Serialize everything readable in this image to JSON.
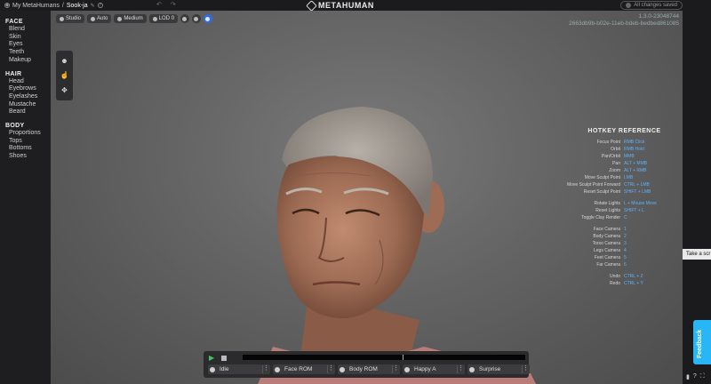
{
  "breadcrumb": {
    "parent": "My MetaHumans",
    "separator": "/",
    "current": "Sook-ja"
  },
  "app": {
    "title": "METAHUMAN"
  },
  "status": {
    "saved": "All changes saved"
  },
  "version": {
    "line1": "1.3.0-23048744",
    "line2": "2663db9b-b02e-11eb-bdeb-bedbed861085"
  },
  "toolbar": {
    "studio": "Studio",
    "auto": "Auto",
    "medium": "Medium",
    "lod": "LOD 0"
  },
  "sidebar": {
    "sections": [
      {
        "title": "FACE",
        "items": [
          "Blend",
          "Skin",
          "Eyes",
          "Teeth",
          "Makeup"
        ]
      },
      {
        "title": "HAIR",
        "items": [
          "Head",
          "Eyebrows",
          "Eyelashes",
          "Mustache",
          "Beard"
        ]
      },
      {
        "title": "BODY",
        "items": [
          "Proportions",
          "Tops",
          "Bottoms",
          "Shoes"
        ]
      }
    ]
  },
  "hotkeys": {
    "title": "HOTKEY REFERENCE",
    "groups": [
      [
        {
          "a": "Focus Point",
          "k": "RMB Click"
        },
        {
          "a": "Orbit",
          "k": "RMB Hold"
        },
        {
          "a": "Pan/Orbit",
          "k": "MMB"
        },
        {
          "a": "Pan",
          "k": "ALT + MMB"
        },
        {
          "a": "Zoom",
          "k": "ALT + RMB"
        },
        {
          "a": "Move Sculpt Point",
          "k": "LMB"
        },
        {
          "a": "Move Sculpt Point Forward",
          "k": "CTRL + LMB"
        },
        {
          "a": "Reset Sculpt Point",
          "k": "SHIFT + LMB"
        }
      ],
      [
        {
          "a": "Rotate Lights",
          "k": "L + Mouse Move"
        },
        {
          "a": "Reset Lights",
          "k": "SHIFT + L"
        },
        {
          "a": "Toggle Clay Render",
          "k": "C"
        }
      ],
      [
        {
          "a": "Face Camera",
          "k": "1"
        },
        {
          "a": "Body Camera",
          "k": "2"
        },
        {
          "a": "Torso Camera",
          "k": "3"
        },
        {
          "a": "Legs Camera",
          "k": "4"
        },
        {
          "a": "Feet Camera",
          "k": "5"
        },
        {
          "a": "Far Camera",
          "k": "6"
        }
      ],
      [
        {
          "a": "Undo",
          "k": "CTRL + Z"
        },
        {
          "a": "Redo",
          "k": "CTRL + Y"
        }
      ]
    ]
  },
  "animations": [
    "Idle",
    "Face ROM",
    "Body ROM",
    "Happy A",
    "Surprise"
  ],
  "tooltip": "Take a scr",
  "feedback": "Feedback"
}
